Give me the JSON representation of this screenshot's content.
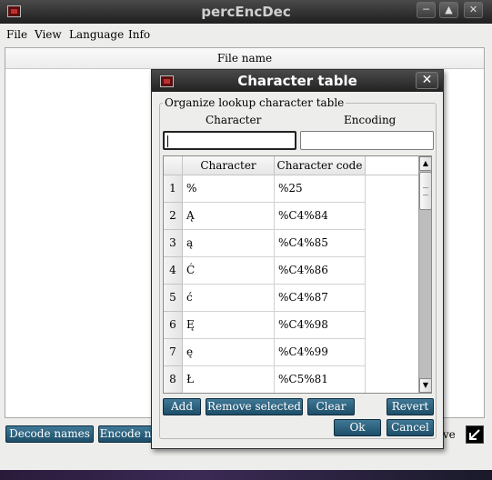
{
  "window": {
    "title": "percEncDec"
  },
  "menu": {
    "items": [
      "File",
      "View",
      "Language",
      "Info"
    ]
  },
  "file_list": {
    "header": "File name"
  },
  "bottom_buttons": {
    "decode": "Decode names",
    "encode": "Encode n"
  },
  "live_label": "ive",
  "dialog": {
    "title": "Character table",
    "group_title": "Organize lookup character table",
    "character_label": "Character",
    "encoding_label": "Encoding",
    "character_value": "",
    "encoding_value": "",
    "table": {
      "columns": [
        "Character",
        "Character code"
      ],
      "rows": [
        {
          "num": "1",
          "char": "%",
          "code": "%25"
        },
        {
          "num": "2",
          "char": "Ą",
          "code": "%C4%84"
        },
        {
          "num": "3",
          "char": "ą",
          "code": "%C4%85"
        },
        {
          "num": "4",
          "char": "Ć",
          "code": "%C4%86"
        },
        {
          "num": "5",
          "char": "ć",
          "code": "%C4%87"
        },
        {
          "num": "6",
          "char": "Ę",
          "code": "%C4%98"
        },
        {
          "num": "7",
          "char": "ę",
          "code": "%C4%99"
        },
        {
          "num": "8",
          "char": "Ł",
          "code": "%C5%81"
        }
      ]
    },
    "buttons": {
      "add": "Add",
      "remove": "Remove selected",
      "clear": "Clear",
      "revert": "Revert",
      "ok": "Ok",
      "cancel": "Cancel"
    }
  },
  "colors": {
    "button": "#2b5f7b",
    "titlebar": "#2e2e2e"
  }
}
